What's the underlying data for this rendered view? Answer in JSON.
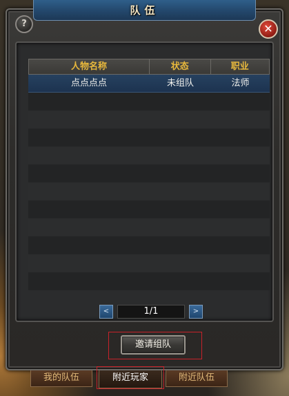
{
  "window": {
    "title": "队伍",
    "help_label": "?",
    "close_label": "✕"
  },
  "table": {
    "columns": [
      "人物名称",
      "状态",
      "职业"
    ],
    "rows": [
      [
        "点点点点",
        "未组队",
        "法师"
      ]
    ]
  },
  "pager": {
    "prev_label": "<",
    "next_label": ">",
    "page_text": "1/1"
  },
  "actions": {
    "invite_label": "邀请组队"
  },
  "tabs": [
    {
      "label": "我的队伍",
      "active": false
    },
    {
      "label": "附近玩家",
      "active": true
    },
    {
      "label": "附近队伍",
      "active": false
    }
  ],
  "colors": {
    "header_text": "#e8b83c",
    "title_bar": "#24496e",
    "selected_row": "#1d3350",
    "highlight_outline": "#c8222a"
  }
}
